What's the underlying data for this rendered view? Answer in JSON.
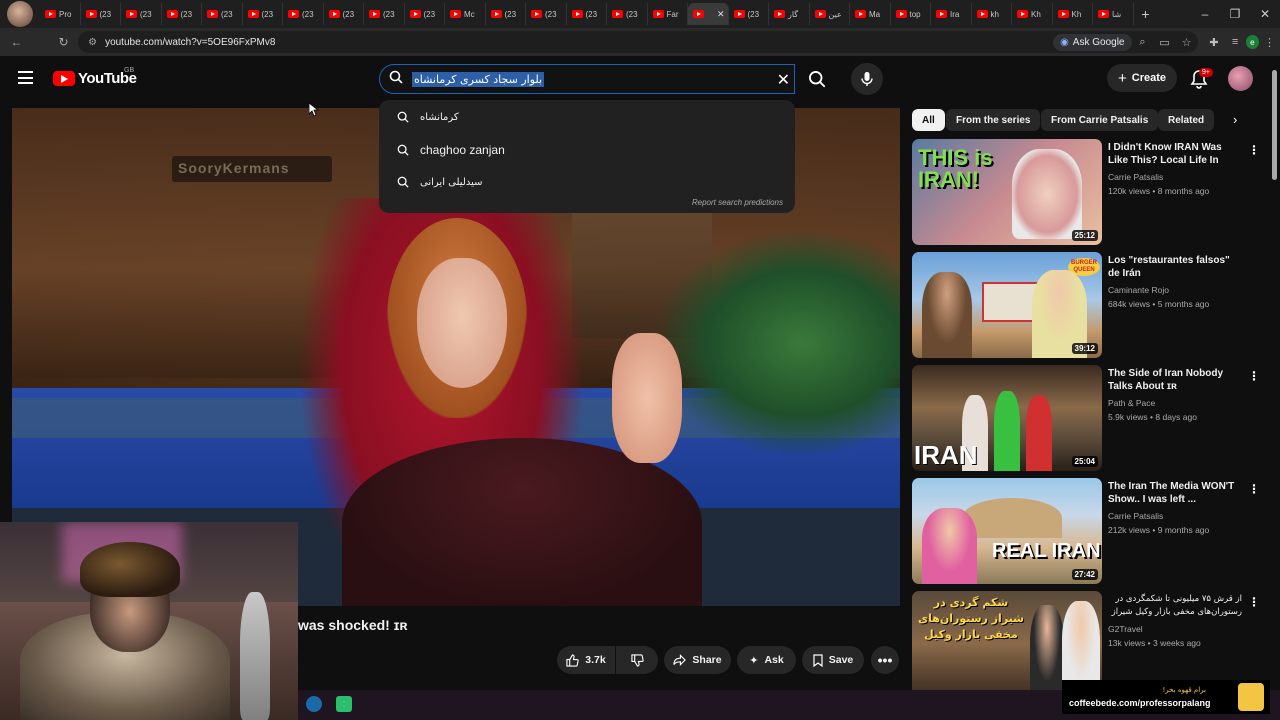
{
  "browser": {
    "tabs": [
      "Pro",
      "(23",
      "(23",
      "(23",
      "(23",
      "(23",
      "(23",
      "(23",
      "(23",
      "(23",
      "Mc",
      "(23",
      "(23",
      "(23",
      "(23",
      "Far",
      "",
      "(23",
      "گار",
      "عین",
      "Ma",
      "top",
      "Ira",
      "kh",
      "Kh",
      "Kh",
      "شا"
    ],
    "active_tab_index": 16,
    "url": "youtube.com/watch?v=5OE96FxPMv8",
    "ask_google": "Ask Google",
    "profile_letter": "e"
  },
  "youtube": {
    "logo_text": "YouTube",
    "region": "GB",
    "search_query": "بلوار سجاد کسری کرمانشاه",
    "suggestions": [
      {
        "text": "کرمانشاه"
      },
      {
        "text": "chaghoo zanjan"
      },
      {
        "text": "سیدلیلی ایرانی"
      }
    ],
    "report_link": "Report search predictions",
    "create_label": "Create",
    "notification_count": "9+"
  },
  "video": {
    "title_fragment": "was shocked! ɪʀ",
    "wall_text": "SooryKermans",
    "actions": {
      "likes": "3.7k",
      "share": "Share",
      "ask": "Ask",
      "save": "Save"
    }
  },
  "chips": [
    "All",
    "From the series",
    "From Carrie Patsalis",
    "Related"
  ],
  "related": [
    {
      "title": "I Didn't Know IRAN Was Like This? Local Life In Qazvin ...",
      "channel": "Carrie Patsalis",
      "meta": "120k views • 8 months ago",
      "duration": "25:12",
      "thumb_text": "THIS is IRAN!"
    },
    {
      "title": "Los \"restaurantes falsos\" de Irán",
      "channel": "Caminante Rojo",
      "meta": "684k views • 5 months ago",
      "duration": "39:12",
      "thumb_text": "BURGER QUEEN"
    },
    {
      "title": "The Side of Iran Nobody Talks About ɪʀ",
      "channel": "Path & Pace",
      "meta": "5.9k views • 8 days ago",
      "duration": "25:04",
      "thumb_text": "IRAN"
    },
    {
      "title": "The Iran The Media WON'T Show.. I was left ...",
      "channel": "Carrie Patsalis",
      "meta": "212k views • 9 months ago",
      "duration": "27:42",
      "thumb_text": "REAL IRAN"
    },
    {
      "title": "از قرش ۷۵ میلیونی تا شکمگردی در رستوران‌های مخفی بازار وکیل شیراز",
      "channel": "G2Travel",
      "meta": "13k views • 3 weeks ago",
      "duration": "",
      "thumb_text": "شکم گردی در شیراز رستوران‌های مخفی بازار وکیل"
    }
  ],
  "overlay": {
    "coffee_line1": "برام قهوه بخر!",
    "coffee_line2": "coffeebede.com/professorpalang"
  },
  "colors": {
    "background": "#0f0f0f",
    "accent_red": "#ff0000",
    "search_focus": "#1c62b9",
    "coffee_yellow": "#f4c542"
  }
}
